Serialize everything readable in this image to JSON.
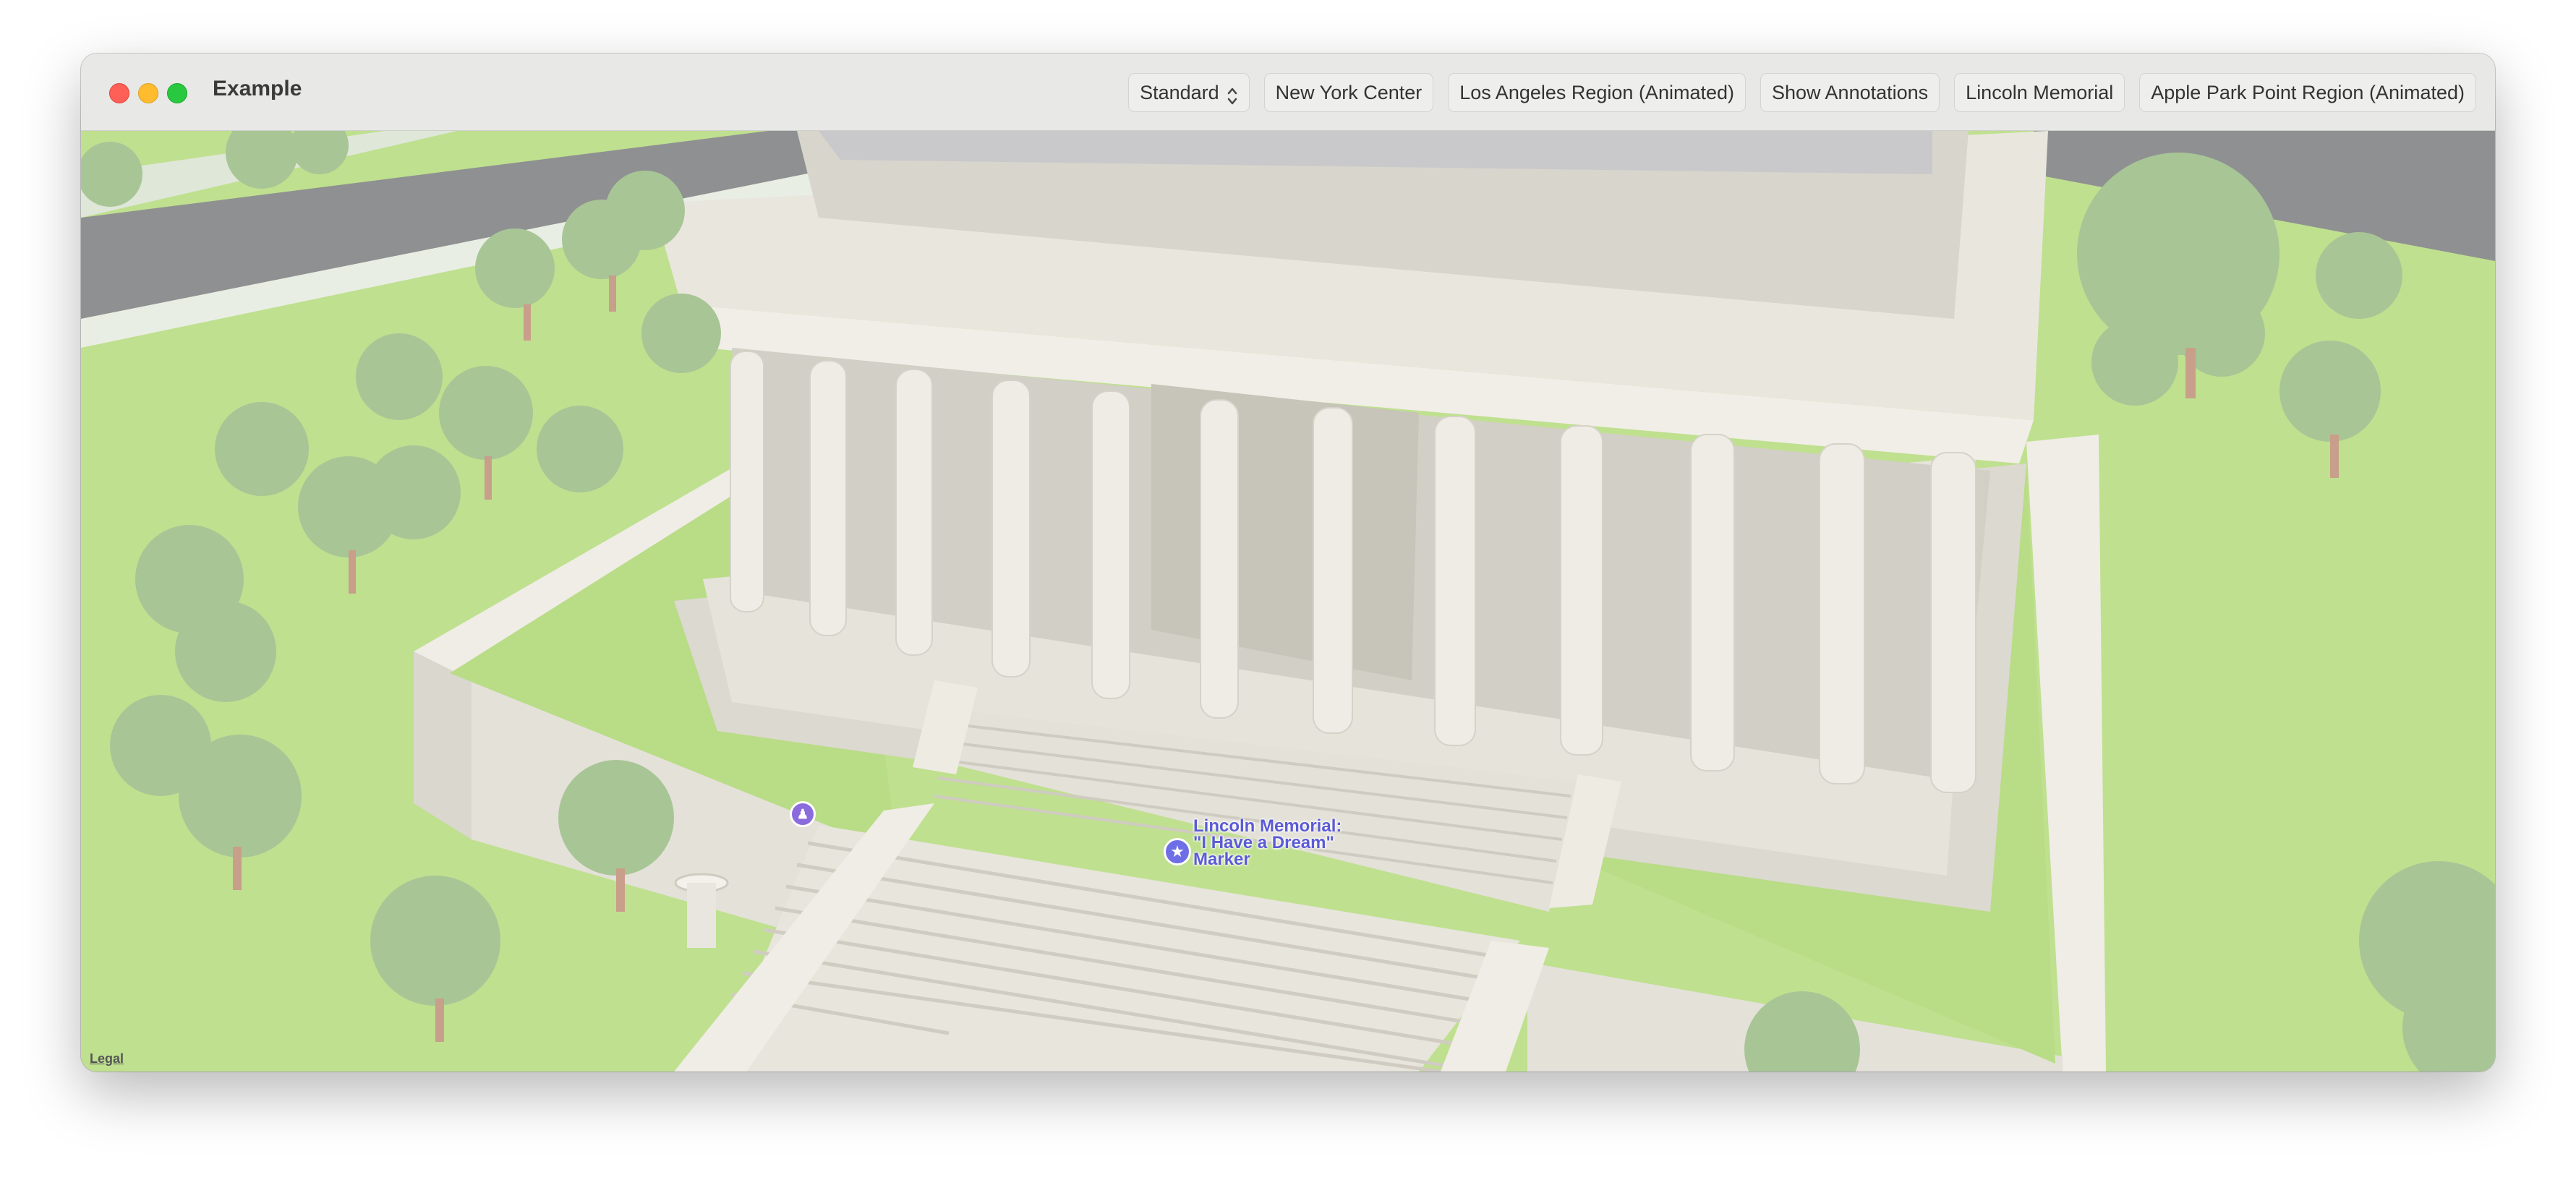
{
  "window": {
    "title": "Example",
    "controls": [
      "close",
      "minimize",
      "zoom"
    ]
  },
  "toolbar": {
    "map_style": {
      "selected": "Standard"
    },
    "buttons": [
      "New York Center",
      "Los Angeles Region (Animated)",
      "Show Annotations",
      "Lincoln Memorial",
      "Apple Park Point Region (Animated)"
    ]
  },
  "map": {
    "annotation": {
      "label": "Lincoln Memorial: \"I Have a Dream\" Marker",
      "icon": "star-icon",
      "color": "#5b5bd6"
    },
    "poi_icon": "restroom-icon",
    "legal_link": "Legal",
    "colors": {
      "grass": "#bfe08f",
      "road": "#8e8e90",
      "marble": "#e6e3da",
      "trees": "#a8c596"
    }
  }
}
